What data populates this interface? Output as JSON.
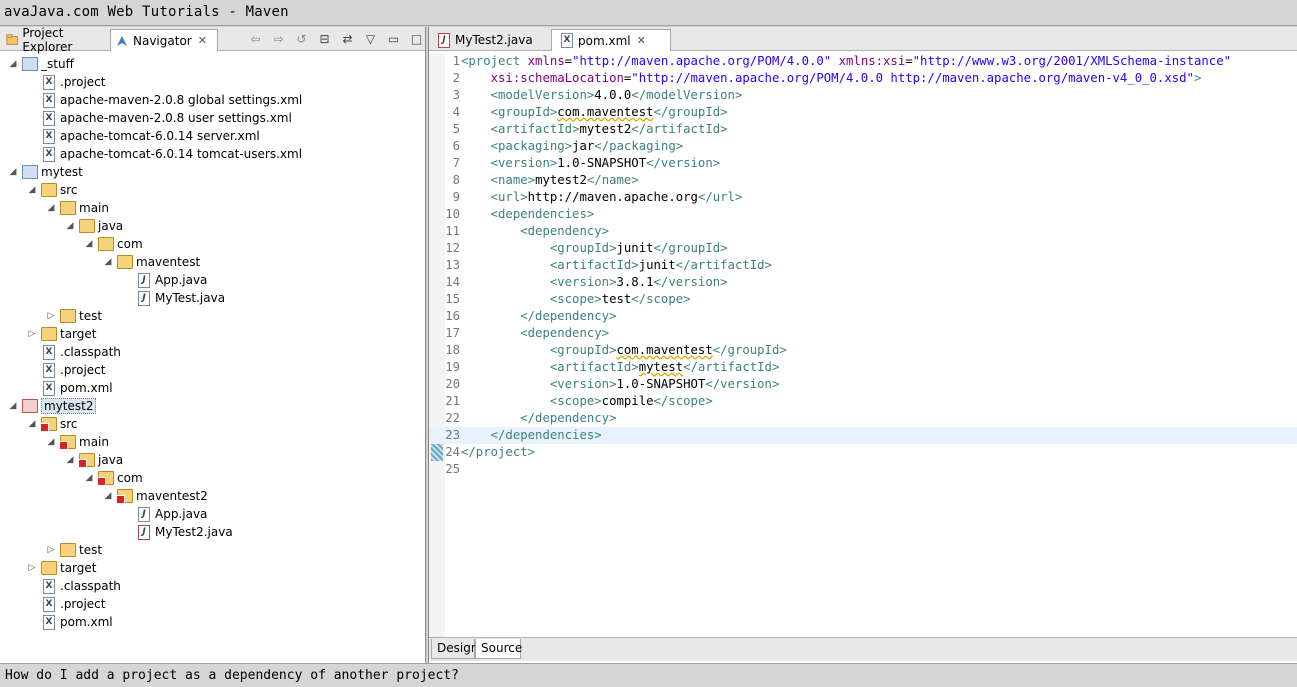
{
  "window": {
    "title": "avaJava.com Web Tutorials - Maven"
  },
  "status": {
    "text": "How do I add a project as a dependency of another project?"
  },
  "left_panel": {
    "tabs": [
      {
        "label": "Project Explorer",
        "active": false
      },
      {
        "label": "Navigator",
        "active": true,
        "close": "✕"
      }
    ],
    "toolbar_icons": [
      "back-arrow-icon",
      "forward-arrow-icon",
      "go-into-icon",
      "collapse-all-icon",
      "link-with-editor-icon",
      "view-menu-icon",
      "minimize-icon",
      "maximize-icon"
    ],
    "toolbar_glyphs": [
      "⇦",
      "⇨",
      "↺",
      "⊟",
      "⇄",
      "▽",
      "▭",
      "□"
    ],
    "tree": [
      {
        "label": "_stuff",
        "kind": "project",
        "twist": "◢"
      },
      {
        "label": ".project",
        "kind": "xml"
      },
      {
        "label": "apache-maven-2.0.8 global settings.xml",
        "kind": "xml"
      },
      {
        "label": "apache-maven-2.0.8 user settings.xml",
        "kind": "xml"
      },
      {
        "label": "apache-tomcat-6.0.14 server.xml",
        "kind": "xml"
      },
      {
        "label": "apache-tomcat-6.0.14 tomcat-users.xml",
        "kind": "xml"
      },
      {
        "label": "mytest",
        "kind": "project",
        "twist": "◢"
      },
      {
        "label": "src",
        "kind": "folder",
        "twist": "◢"
      },
      {
        "label": "main",
        "kind": "folder",
        "twist": "◢"
      },
      {
        "label": "java",
        "kind": "folder",
        "twist": "◢"
      },
      {
        "label": "com",
        "kind": "folder",
        "twist": "◢"
      },
      {
        "label": "maventest",
        "kind": "folder",
        "twist": "◢"
      },
      {
        "label": "App.java",
        "kind": "java"
      },
      {
        "label": "MyTest.java",
        "kind": "java"
      },
      {
        "label": "test",
        "kind": "folder",
        "twist": "▷"
      },
      {
        "label": "target",
        "kind": "folder",
        "twist": "▷"
      },
      {
        "label": ".classpath",
        "kind": "xml"
      },
      {
        "label": ".project",
        "kind": "xml"
      },
      {
        "label": "pom.xml",
        "kind": "xml"
      },
      {
        "label": "mytest2",
        "kind": "project-err",
        "twist": "◢",
        "selected": true
      },
      {
        "label": "src",
        "kind": "folder-err",
        "twist": "◢"
      },
      {
        "label": "main",
        "kind": "folder-err",
        "twist": "◢"
      },
      {
        "label": "java",
        "kind": "folder-err",
        "twist": "◢"
      },
      {
        "label": "com",
        "kind": "folder-err",
        "twist": "◢"
      },
      {
        "label": "maventest2",
        "kind": "folder-err",
        "twist": "◢"
      },
      {
        "label": "App.java",
        "kind": "java"
      },
      {
        "label": "MyTest2.java",
        "kind": "java-err"
      },
      {
        "label": "test",
        "kind": "folder",
        "twist": "▷"
      },
      {
        "label": "target",
        "kind": "folder",
        "twist": "▷"
      },
      {
        "label": ".classpath",
        "kind": "xml"
      },
      {
        "label": ".project",
        "kind": "xml"
      },
      {
        "label": "pom.xml",
        "kind": "xml"
      }
    ]
  },
  "editor": {
    "tabs": [
      {
        "label": "MyTest2.java",
        "active": false
      },
      {
        "label": "pom.xml",
        "active": true,
        "close": "✕"
      }
    ],
    "bottom_tabs": [
      {
        "label": "Design",
        "active": false
      },
      {
        "label": "Source",
        "active": true
      }
    ],
    "current_line": 23,
    "lines": [
      "1|<project xmlns=\"http://maven.apache.org/POM/4.0.0\" xmlns:xsi=\"http://www.w3.org/2001/XMLSchema-instance\"",
      "2|    xsi:schemaLocation=\"http://maven.apache.org/POM/4.0.0 http://maven.apache.org/maven-v4_0_0.xsd\">",
      "3|    <modelVersion>4.0.0</modelVersion>",
      "4|    <groupId>com.maventest</groupId>",
      "5|    <artifactId>mytest2</artifactId>",
      "6|    <packaging>jar</packaging>",
      "7|    <version>1.0-SNAPSHOT</version>",
      "8|    <name>mytest2</name>",
      "9|    <url>http://maven.apache.org</url>",
      "10|    <dependencies>",
      "11|        <dependency>",
      "12|            <groupId>junit</groupId>",
      "13|            <artifactId>junit</artifactId>",
      "14|            <version>3.8.1</version>",
      "15|            <scope>test</scope>",
      "16|        </dependency>",
      "17|        <dependency>",
      "18|            <groupId>com.maventest</groupId>",
      "19|            <artifactId>mytest</artifactId>",
      "20|            <version>1.0-SNAPSHOT</version>",
      "21|            <scope>compile</scope>",
      "22|        </dependency>",
      "23|    </dependencies>",
      "24|</project>",
      "25|"
    ]
  }
}
